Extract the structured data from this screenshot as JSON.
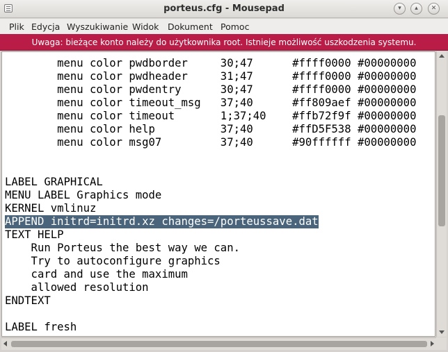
{
  "window": {
    "title": "porteus.cfg - Mousepad"
  },
  "menubar": {
    "items": [
      {
        "label": "Plik"
      },
      {
        "label": "Edycja"
      },
      {
        "label": "Wyszukiwanie"
      },
      {
        "label": "Widok"
      },
      {
        "label": "Dokument"
      },
      {
        "label": "Pomoc"
      }
    ]
  },
  "warning": {
    "text": "Uwaga: bieżące konto należy do użytkownika root. Istnieje możliwość uszkodzenia systemu."
  },
  "editor": {
    "lines": [
      "        menu color pwdborder     30;47      #ffff0000 #00000000",
      "        menu color pwdheader     31;47      #ffff0000 #00000000",
      "        menu color pwdentry      30;47      #ffff0000 #00000000",
      "        menu color timeout_msg   37;40      #ff809aef #00000000",
      "        menu color timeout       1;37;40    #ffb72f9f #00000000",
      "        menu color help          37;40      #ffD5F538 #00000000",
      "        menu color msg07         37;40      #90ffffff #00000000",
      "",
      "",
      "LABEL GRAPHICAL",
      "MENU LABEL Graphics mode",
      "KERNEL vmlinuz",
      "APPEND initrd=initrd.xz changes=/porteussave.dat",
      "TEXT HELP",
      "    Run Porteus the best way we can.",
      "    Try to autoconfigure graphics",
      "    card and use the maximum",
      "    allowed resolution",
      "ENDTEXT",
      "",
      "LABEL fresh"
    ],
    "selected_line": "APPEND initrd=initrd.xz changes=/porteussave.dat"
  },
  "colors": {
    "warning_bg": "#b91d47",
    "selection_bg": "#49647b"
  }
}
